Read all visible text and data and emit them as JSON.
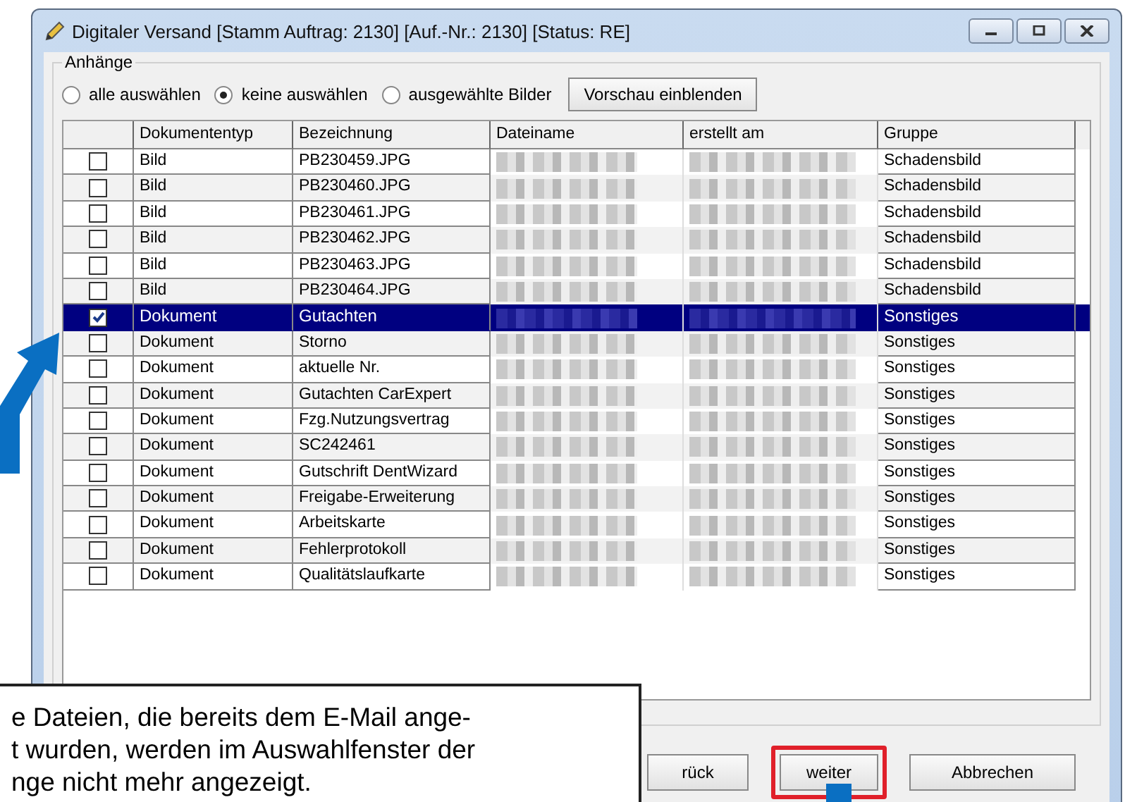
{
  "window": {
    "title": "Digitaler Versand [Stamm Auftrag: 2130]  [Auf.-Nr.: 2130]  [Status: RE]"
  },
  "group": {
    "label": "Anhänge"
  },
  "radios": [
    {
      "label": "alle auswählen",
      "selected": false
    },
    {
      "label": "keine auswählen",
      "selected": true
    },
    {
      "label": "ausgewählte Bilder",
      "selected": false
    }
  ],
  "preview_button": "Vorschau einblenden",
  "table": {
    "columns": [
      "Dokumententyp",
      "Bezeichnung",
      "Dateiname",
      "erstellt am",
      "Gruppe"
    ],
    "rows": [
      {
        "type": "Bild",
        "name": "PB230459.JPG",
        "group": "Schadensbild",
        "checked": false,
        "selected": false
      },
      {
        "type": "Bild",
        "name": "PB230460.JPG",
        "group": "Schadensbild",
        "checked": false,
        "selected": false
      },
      {
        "type": "Bild",
        "name": "PB230461.JPG",
        "group": "Schadensbild",
        "checked": false,
        "selected": false
      },
      {
        "type": "Bild",
        "name": "PB230462.JPG",
        "group": "Schadensbild",
        "checked": false,
        "selected": false
      },
      {
        "type": "Bild",
        "name": "PB230463.JPG",
        "group": "Schadensbild",
        "checked": false,
        "selected": false
      },
      {
        "type": "Bild",
        "name": "PB230464.JPG",
        "group": "Schadensbild",
        "checked": false,
        "selected": false
      },
      {
        "type": "Dokument",
        "name": "Gutachten",
        "group": "Sonstiges",
        "checked": true,
        "selected": true
      },
      {
        "type": "Dokument",
        "name": "Storno",
        "group": "Sonstiges",
        "checked": false,
        "selected": false
      },
      {
        "type": "Dokument",
        "name": "aktuelle Nr.",
        "group": "Sonstiges",
        "checked": false,
        "selected": false
      },
      {
        "type": "Dokument",
        "name": "Gutachten CarExpert",
        "group": "Sonstiges",
        "checked": false,
        "selected": false
      },
      {
        "type": "Dokument",
        "name": "Fzg.Nutzungsvertrag",
        "group": "Sonstiges",
        "checked": false,
        "selected": false
      },
      {
        "type": "Dokument",
        "name": "SC242461",
        "group": "Sonstiges",
        "checked": false,
        "selected": false
      },
      {
        "type": "Dokument",
        "name": "Gutschrift DentWizard",
        "group": "Sonstiges",
        "checked": false,
        "selected": false
      },
      {
        "type": "Dokument",
        "name": "Freigabe-Erweiterung",
        "group": "Sonstiges",
        "checked": false,
        "selected": false
      },
      {
        "type": "Dokument",
        "name": "Arbeitskarte",
        "group": "Sonstiges",
        "checked": false,
        "selected": false
      },
      {
        "type": "Dokument",
        "name": "Fehlerprotokoll",
        "group": "Sonstiges",
        "checked": false,
        "selected": false
      },
      {
        "type": "Dokument",
        "name": "Qualitätslaufkarte",
        "group": "Sonstiges",
        "checked": false,
        "selected": false
      }
    ]
  },
  "buttons": [
    {
      "label": "rück",
      "highlighted": false
    },
    {
      "label": "weiter",
      "highlighted": true
    },
    {
      "label": "Abbrechen",
      "highlighted": false
    }
  ],
  "callout": {
    "lines": [
      "e Dateien, die bereits dem E-Mail ange-",
      "t wurden, werden im Auswahlfenster der",
      "nge nicht mehr angezeigt."
    ]
  }
}
